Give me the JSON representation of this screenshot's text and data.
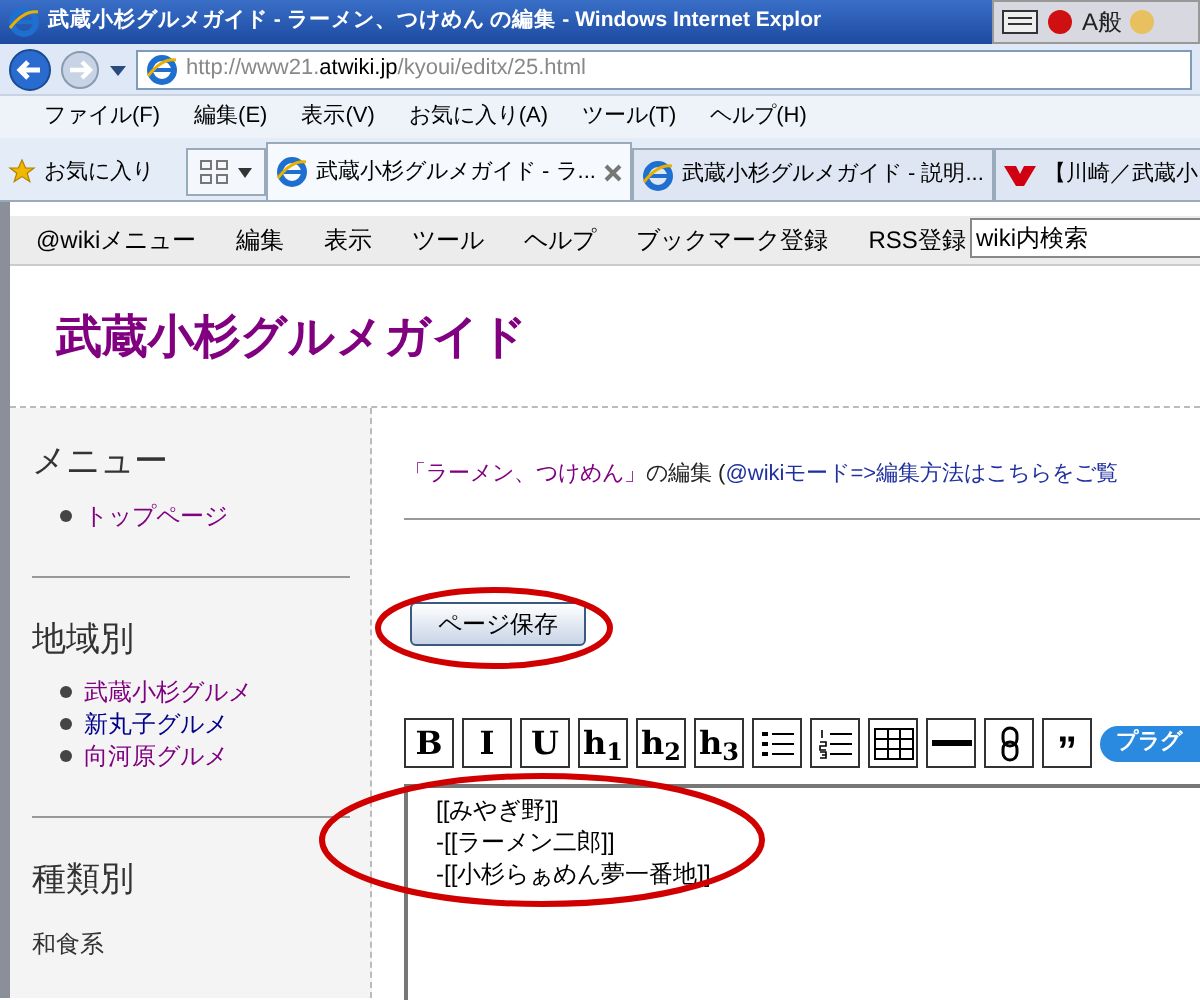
{
  "window": {
    "title": "武蔵小杉グルメガイド - ラーメン、つけめん の編集 - Windows Internet Explor",
    "language_bar": "A般"
  },
  "address_bar": {
    "url_prefix": "http://www21.",
    "url_domain": "atwiki.jp",
    "url_path": "/kyoui/editx/25.html"
  },
  "menu_bar": [
    "ファイル(F)",
    "編集(E)",
    "表示(V)",
    "お気に入り(A)",
    "ツール(T)",
    "ヘルプ(H)"
  ],
  "favorites": "お気に入り",
  "tabs": [
    {
      "label": "武蔵小杉グルメガイド - ラ...",
      "selected": true,
      "kind": "ie"
    },
    {
      "label": "武蔵小杉グルメガイド - 説明...",
      "selected": false,
      "kind": "ie"
    },
    {
      "label": "【川崎／武蔵小",
      "selected": false,
      "kind": "yahoo"
    }
  ],
  "wiki_menu": [
    "@wikiメニュー",
    "編集",
    "表示",
    "ツール",
    "ヘルプ",
    "ブックマーク登録",
    "RSS登録"
  ],
  "search": {
    "value": "wiki内検索"
  },
  "site_title": "武蔵小杉グルメガイド",
  "sidebar": {
    "sections": [
      {
        "heading": "メニュー",
        "items": [
          {
            "label": "トップページ",
            "visited": true
          }
        ]
      },
      {
        "heading": "地域別",
        "items": [
          {
            "label": "武蔵小杉グルメ",
            "visited": true
          },
          {
            "label": "新丸子グルメ",
            "visited": false
          },
          {
            "label": "向河原グルメ",
            "visited": true
          }
        ]
      },
      {
        "heading": "種類別"
      }
    ],
    "footer_text": "和食系"
  },
  "edit_heading": {
    "page_link": "「ラーメン、つけめん」",
    "text": "の編集 (",
    "mode_link": "@wikiモード=>編集方法はこちらをご覧"
  },
  "save_button": "ページ保存",
  "toolbar": [
    {
      "kind": "text",
      "label": "B"
    },
    {
      "kind": "text",
      "label": "I"
    },
    {
      "kind": "text",
      "label": "U"
    },
    {
      "kind": "text",
      "label": "h$_{1}$"
    },
    {
      "kind": "text",
      "label": "h$_{2}$"
    },
    {
      "kind": "text",
      "label": "h$_{3}$"
    },
    {
      "kind": "bullets"
    },
    {
      "kind": "numbers"
    },
    {
      "kind": "table"
    },
    {
      "kind": "rule"
    },
    {
      "kind": "link"
    },
    {
      "kind": "quote",
      "label": "”"
    },
    {
      "kind": "pill",
      "label": "プラグ"
    }
  ],
  "editor_lines": [
    "[[みやぎ野]]",
    "-[[ラーメン二郎]]",
    "-[[小杉らぁめん夢一番地]]"
  ]
}
